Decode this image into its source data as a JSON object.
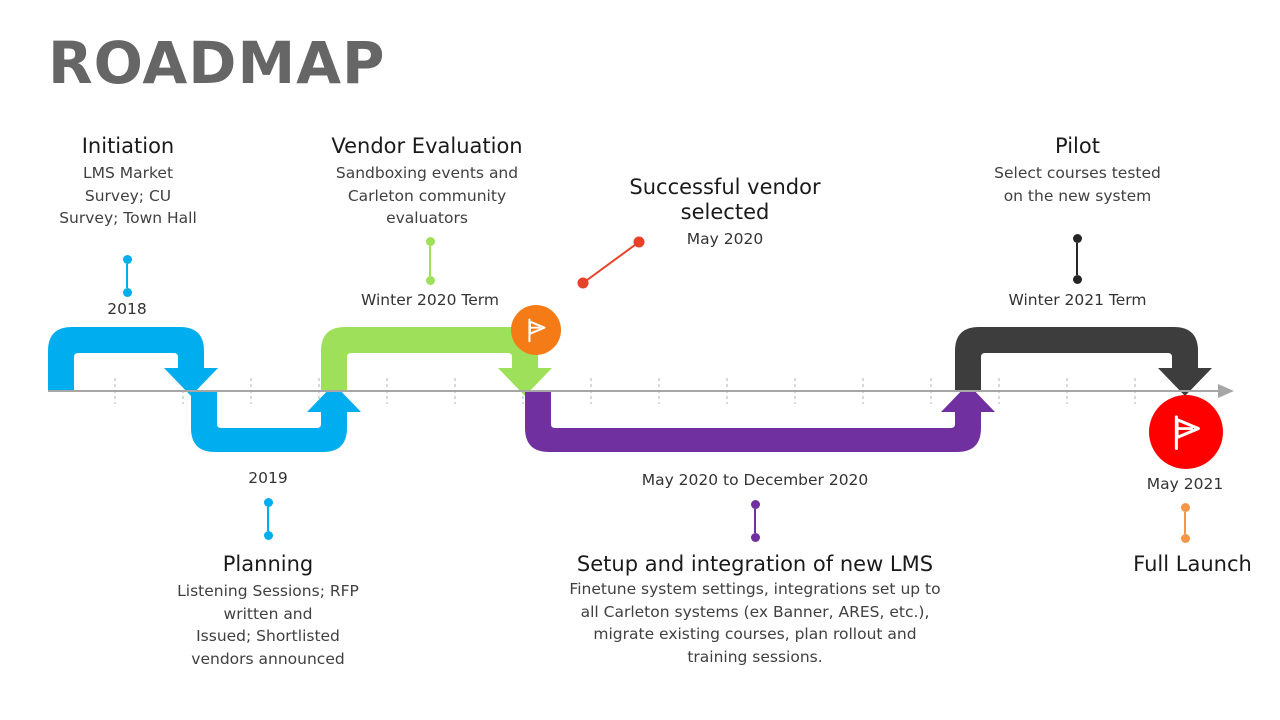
{
  "title": "ROADMAP",
  "colors": {
    "blue": "#00AEEF",
    "green": "#9FE05A",
    "purple": "#7030A0",
    "dark": "#3D3D3D",
    "orange": "#F47B16",
    "red": "#FF0000",
    "orange_dot": "#F79646",
    "axis": "#A6A6A6",
    "title_gray": "#666666"
  },
  "milestones": [
    {
      "key": "initiation",
      "title": "Initiation",
      "desc": "LMS Market\nSurvey; CU\nSurvey; Town Hall",
      "date": "2018",
      "connector_color": "#00AEEF",
      "position": "above"
    },
    {
      "key": "planning",
      "title": "Planning",
      "desc": "Listening Sessions; RFP\nwritten and\nIssued; Shortlisted\nvendors announced",
      "date": "2019",
      "connector_color": "#00AEEF",
      "position": "below"
    },
    {
      "key": "vendor-evaluation",
      "title": "Vendor  Evaluation",
      "desc": "Sandboxing events and\nCarleton community\nevaluators",
      "date": "Winter 2020 Term",
      "connector_color": "#9FE05A",
      "position": "above"
    },
    {
      "key": "successful-vendor",
      "title": "Successful vendor\nselected",
      "desc": "",
      "date": "May 2020",
      "connector_color": "#E8412A",
      "position": "above"
    },
    {
      "key": "setup-integration",
      "title": "Setup and integration of new LMS",
      "desc": "Finetune system settings, integrations set up to\nall Carleton systems (ex Banner, ARES, etc.),\nmigrate existing courses, plan rollout and\ntraining sessions.",
      "date": "May 2020 to December 2020",
      "connector_color": "#7030A0",
      "position": "below"
    },
    {
      "key": "pilot",
      "title": "Pilot",
      "desc": "Select courses tested\non the new system",
      "date": "Winter 2021 Term",
      "connector_color": "#262626",
      "position": "above"
    },
    {
      "key": "full-launch",
      "title": "Full Launch",
      "desc": "",
      "date": "May 2021",
      "connector_color": "#F79646",
      "position": "below"
    }
  ],
  "badges": [
    {
      "key": "vendor-selected-flag",
      "icon": "flag-icon",
      "color": "#F47B16"
    },
    {
      "key": "full-launch-flag",
      "icon": "flag-icon",
      "color": "#FF0000"
    }
  ],
  "chart_data": {
    "type": "timeline",
    "title": "ROADMAP",
    "axis": {
      "orientation": "horizontal",
      "ticks": 18,
      "arrow_end": "right"
    },
    "segments": [
      {
        "label": "Initiation",
        "color": "#00AEEF",
        "side": "above",
        "date": "2018"
      },
      {
        "label": "Planning",
        "color": "#00AEEF",
        "side": "below",
        "date": "2019"
      },
      {
        "label": "Vendor Evaluation",
        "color": "#9FE05A",
        "side": "above",
        "date": "Winter 2020 Term"
      },
      {
        "label": "Setup and integration of new LMS",
        "color": "#7030A0",
        "side": "below",
        "date": "May 2020 to December 2020"
      },
      {
        "label": "Pilot",
        "color": "#3D3D3D",
        "side": "above",
        "date": "Winter 2021 Term"
      }
    ],
    "markers": [
      {
        "label": "Successful vendor selected",
        "date": "May 2020",
        "color": "#F47B16"
      },
      {
        "label": "Full Launch",
        "date": "May 2021",
        "color": "#FF0000"
      }
    ]
  }
}
